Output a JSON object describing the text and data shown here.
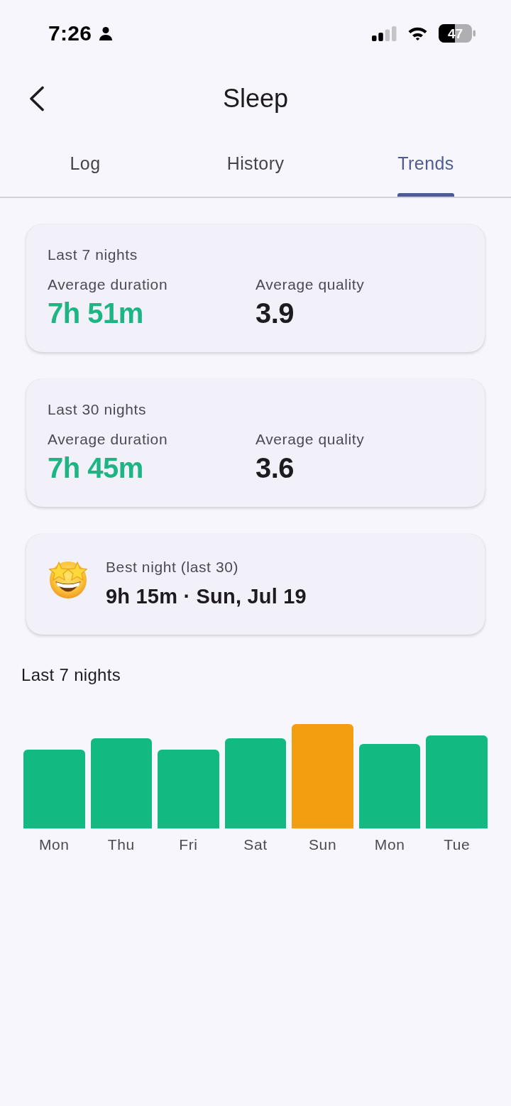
{
  "status_bar": {
    "time": "7:26",
    "battery": "47"
  },
  "header": {
    "title": "Sleep"
  },
  "tabs": [
    {
      "label": "Log",
      "selected": false
    },
    {
      "label": "History",
      "selected": false
    },
    {
      "label": "Trends",
      "selected": true
    }
  ],
  "summary_cards": [
    {
      "period": "Last 7 nights",
      "stats": [
        {
          "kind": "duration",
          "label": "Average duration",
          "value": "7h 51m"
        },
        {
          "kind": "quality",
          "label": "Average quality",
          "value": "3.9"
        }
      ]
    },
    {
      "period": "Last 30 nights",
      "stats": [
        {
          "kind": "duration",
          "label": "Average duration",
          "value": "7h 45m"
        },
        {
          "kind": "quality",
          "label": "Average quality",
          "value": "3.6"
        }
      ]
    }
  ],
  "best_night": {
    "label": "Best night (last 30)",
    "value": "9h 15m · Sun, Jul 19"
  },
  "chart": {
    "title": "Last 7 nights",
    "bars": [
      {
        "label": "Mon",
        "color": "#12b981"
      },
      {
        "label": "Thu",
        "color": "#12b981"
      },
      {
        "label": "Fri",
        "color": "#12b981"
      },
      {
        "label": "Sat",
        "color": "#12b981"
      },
      {
        "label": "Sun",
        "color": "#f39e10"
      },
      {
        "label": "Mon",
        "color": "#12b981"
      },
      {
        "label": "Tue",
        "color": "#12b981"
      }
    ]
  }
}
